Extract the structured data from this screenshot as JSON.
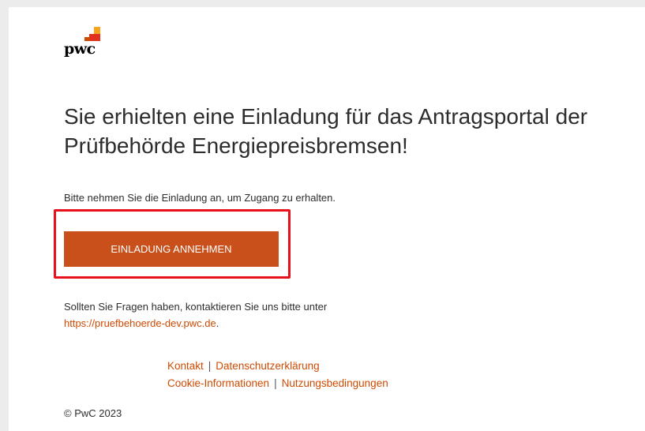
{
  "brand": {
    "wordmark": "pwc",
    "colors": {
      "accent": "#d04a02",
      "button": "#c9501a",
      "highlight_border": "#e8101a"
    }
  },
  "email": {
    "headline": "Sie erhielten eine Einladung für das Antragsportal der Prüfbehörde Energiepreisbremsen!",
    "intro": "Bitte nehmen Sie die Einladung an, um Zugang zu erhalten.",
    "accept_button": "EINLADUNG ANNEHMEN",
    "contact_text": "Sollten Sie Fragen haben, kontaktieren Sie uns bitte unter",
    "contact_link": "https://pruefbehoerde-dev.pwc.de",
    "contact_suffix": "."
  },
  "footer": {
    "links": {
      "kontakt": "Kontakt",
      "datenschutz": "Datenschutzerklärung",
      "cookies": "Cookie-Informationen",
      "nutzung": "Nutzungsbedingungen"
    },
    "separator": "|",
    "copyright": "© PwC 2023"
  }
}
